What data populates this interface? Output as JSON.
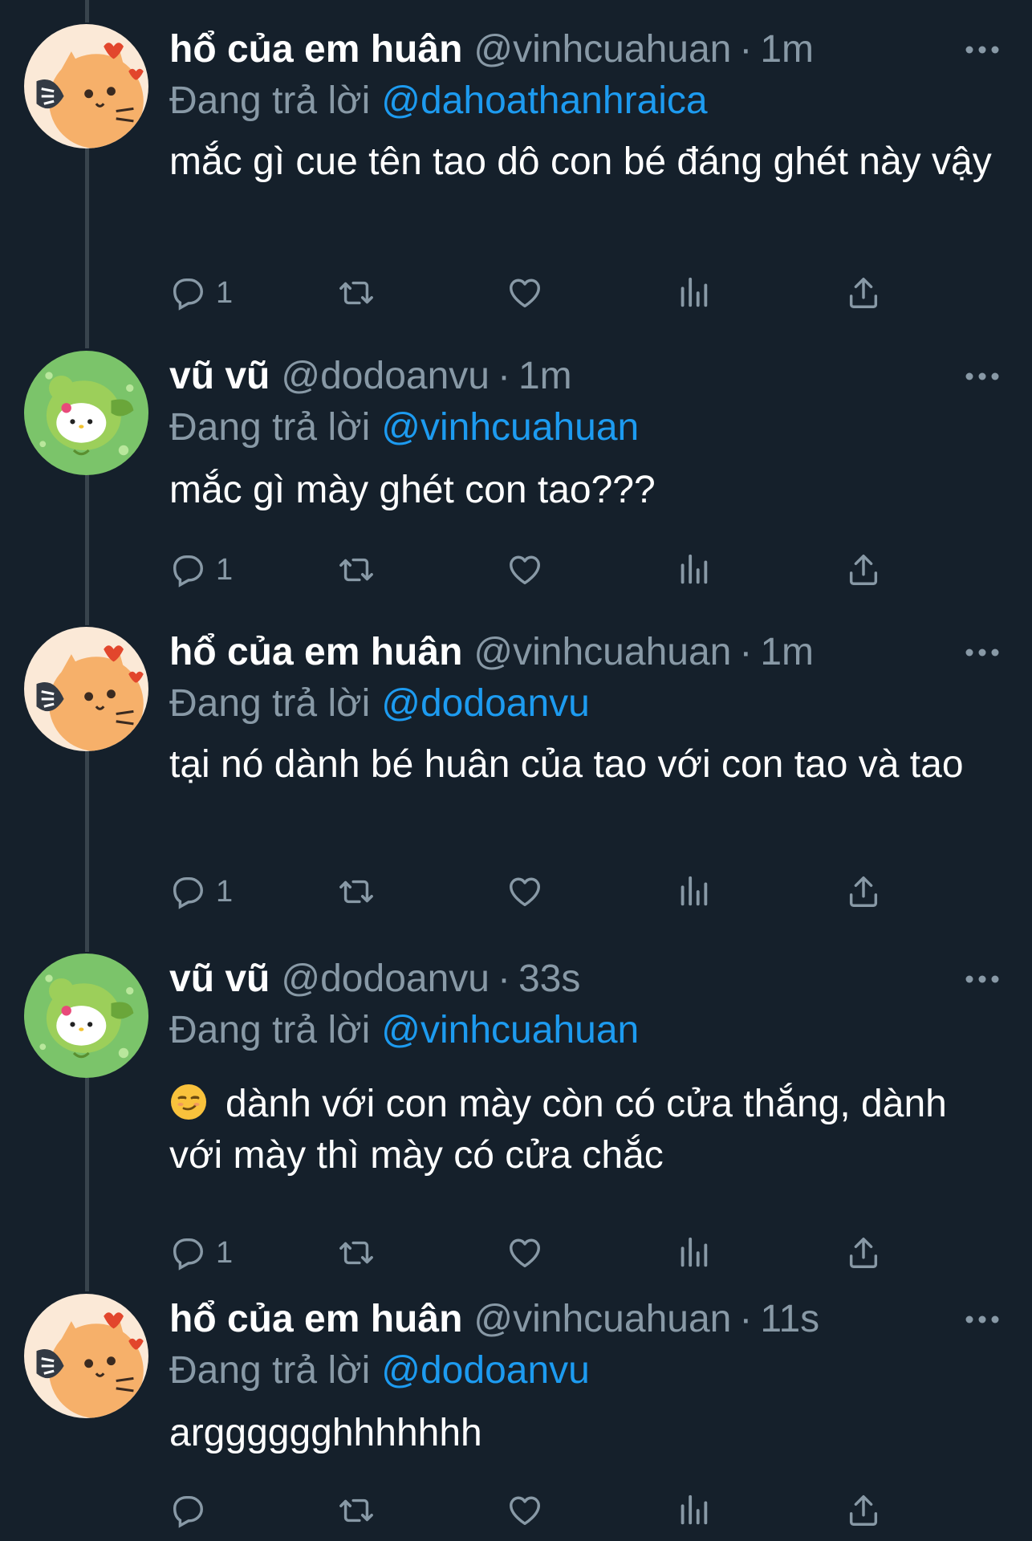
{
  "colors": {
    "background": "#15202b",
    "text": "#ffffff",
    "muted": "#8899a6",
    "mention": "#1d9bf0",
    "thread_line": "#38444d"
  },
  "reply_label": "Đang trả lời",
  "tweets": [
    {
      "name": "hổ của em huân",
      "handle": "@vinhcuahuan",
      "time": "1m",
      "reply_to": "@dahoathanhraica",
      "text": "mắc gì cue tên tao dô con bé đáng ghét này vậy",
      "reply_count": "1",
      "avatar": "tiger-cat-avatar"
    },
    {
      "name": "vũ vũ",
      "handle": "@dodoanvu",
      "time": "1m",
      "reply_to": "@vinhcuahuan",
      "text": "mắc gì mày ghét con tao???",
      "reply_count": "1",
      "avatar": "hello-kitty-frog-avatar"
    },
    {
      "name": "hổ của em huân",
      "handle": "@vinhcuahuan",
      "time": "1m",
      "reply_to": "@dodoanvu",
      "text": "tại nó dành bé huân của tao với con tao và tao",
      "reply_count": "1",
      "avatar": "tiger-cat-avatar"
    },
    {
      "name": "vũ vũ",
      "handle": "@dodoanvu",
      "time": "33s",
      "reply_to": "@vinhcuahuan",
      "text": "dành với con mày còn có cửa thắng, dành với mày thì mày có cửa chắc",
      "emoji": "smirking-face",
      "reply_count": "1",
      "avatar": "hello-kitty-frog-avatar"
    },
    {
      "name": "hổ của em huân",
      "handle": "@vinhcuahuan",
      "time": "11s",
      "reply_to": "@dodoanvu",
      "text": "argggggghhhhhhh",
      "reply_count": "",
      "avatar": "tiger-cat-avatar"
    }
  ]
}
